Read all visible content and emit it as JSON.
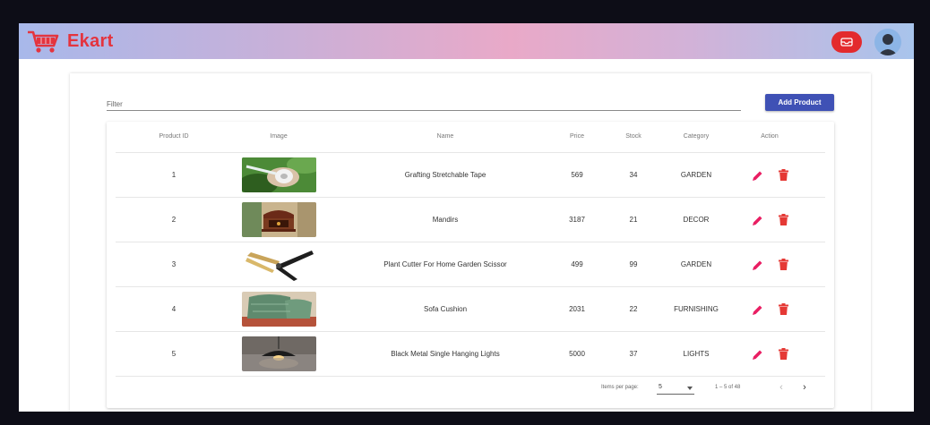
{
  "header": {
    "brand": "Ekart",
    "cart_icon": "shopping-cart-icon",
    "notification_icon": "inbox-icon",
    "avatar_icon": "user-avatar-icon",
    "brand_color": "#e4343e"
  },
  "toolbar": {
    "filter_placeholder": "Filter",
    "add_label": "Add Product",
    "add_color": "#3f51b5"
  },
  "table": {
    "columns": [
      "Product ID",
      "Image",
      "Name",
      "Price",
      "Stock",
      "Category",
      "Action"
    ],
    "rows": [
      {
        "id": "1",
        "image": "grafting-tape-photo",
        "name": "Grafting Stretchable Tape",
        "price": "569",
        "stock": "34",
        "category": "GARDEN"
      },
      {
        "id": "2",
        "image": "mandir-photo",
        "name": "Mandirs",
        "price": "3187",
        "stock": "21",
        "category": "DECOR"
      },
      {
        "id": "3",
        "image": "plant-cutter-photo",
        "name": "Plant Cutter For Home Garden Scissor",
        "price": "499",
        "stock": "99",
        "category": "GARDEN"
      },
      {
        "id": "4",
        "image": "sofa-cushion-photo",
        "name": "Sofa Cushion",
        "price": "2031",
        "stock": "22",
        "category": "FURNISHING"
      },
      {
        "id": "5",
        "image": "hanging-light-photo",
        "name": "Black Metal Single Hanging Lights",
        "price": "5000",
        "stock": "37",
        "category": "LIGHTS"
      }
    ],
    "edit_icon": "pencil-icon",
    "delete_icon": "trash-icon",
    "action_color": "#e91e63"
  },
  "paginator": {
    "items_per_page_label": "Items per page:",
    "items_per_page": "5",
    "range": "1 – 5 of 48",
    "prev_icon": "chevron-left-icon",
    "next_icon": "chevron-right-icon"
  }
}
